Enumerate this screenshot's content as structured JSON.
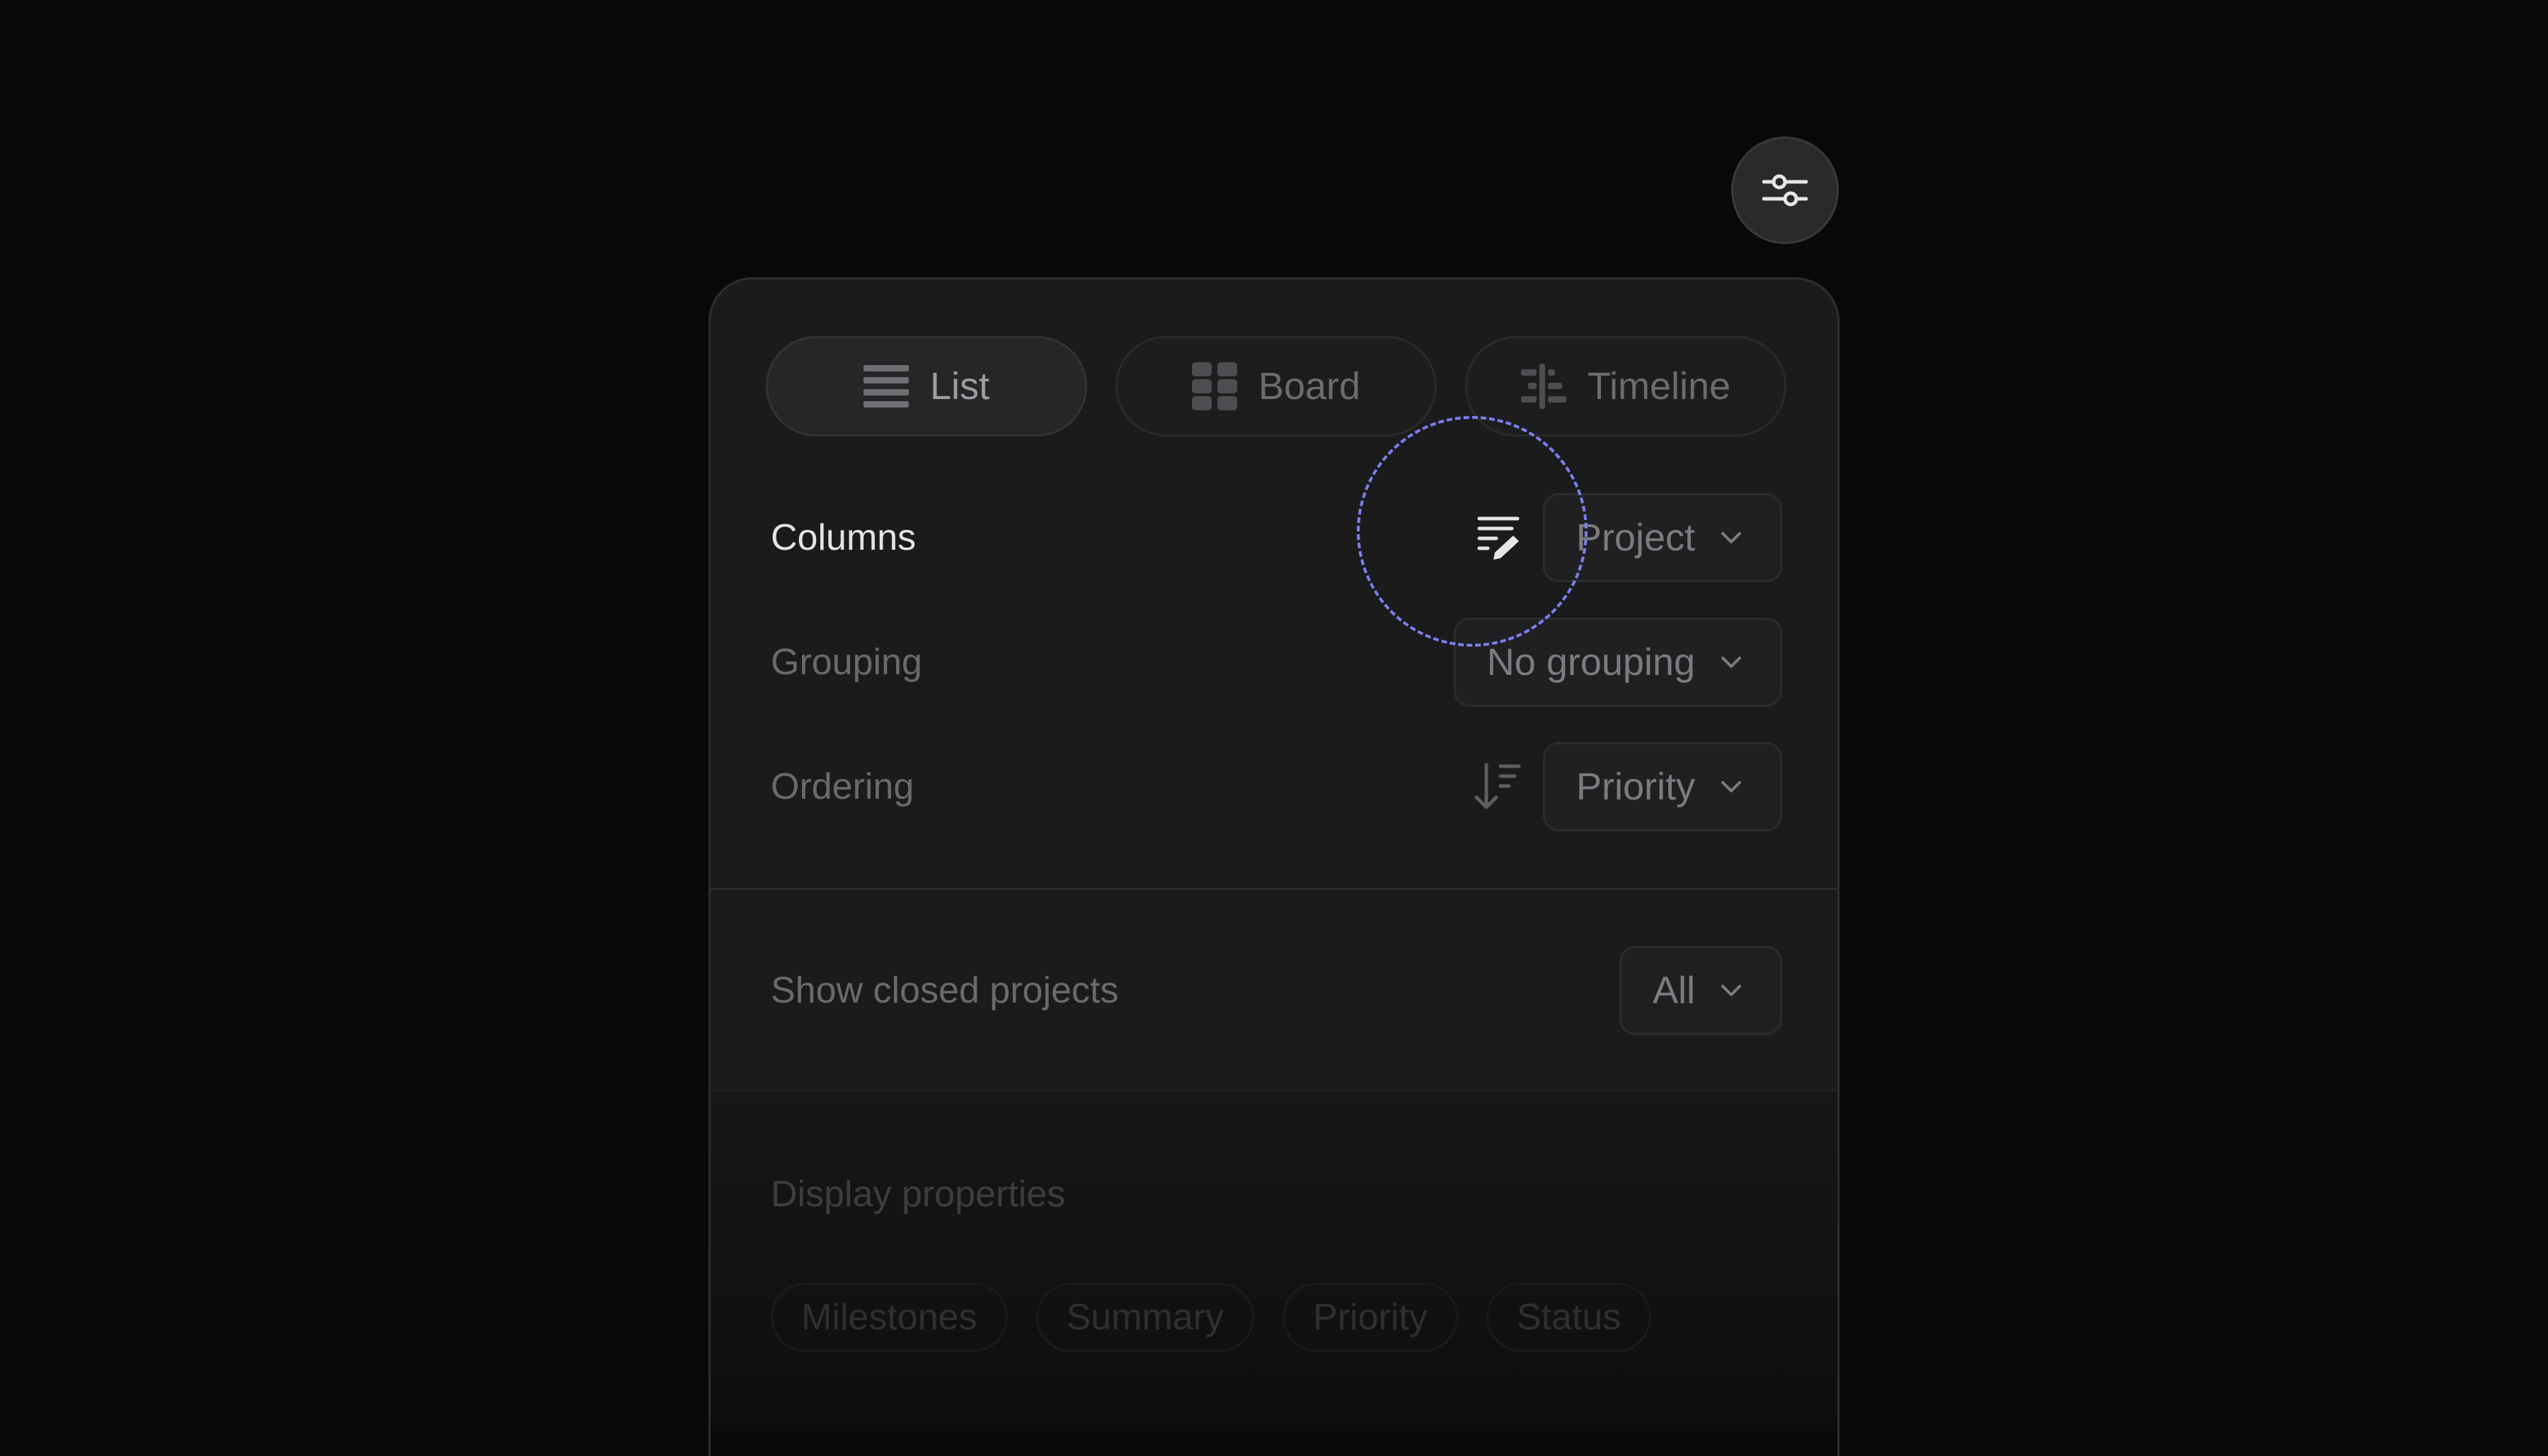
{
  "toolbar": {
    "settings_icon": "sliders-icon"
  },
  "view_tabs": [
    {
      "label": "List",
      "icon": "list-icon",
      "active": true
    },
    {
      "label": "Board",
      "icon": "board-icon",
      "active": false
    },
    {
      "label": "Timeline",
      "icon": "timeline-icon",
      "active": false
    }
  ],
  "options": {
    "columns": {
      "label": "Columns",
      "value": "Project",
      "icon": "edit-columns-icon"
    },
    "grouping": {
      "label": "Grouping",
      "value": "No grouping"
    },
    "ordering": {
      "label": "Ordering",
      "value": "Priority",
      "icon": "sort-descending-icon"
    },
    "closed_projects": {
      "label": "Show closed projects",
      "value": "All"
    }
  },
  "display_properties": {
    "label": "Display properties",
    "chips": [
      "Milestones",
      "Summary",
      "Priority",
      "Status"
    ]
  },
  "colors": {
    "background": "#08090b",
    "panel": "#1b1b1c",
    "focus_ring": "#7b7ff0"
  }
}
